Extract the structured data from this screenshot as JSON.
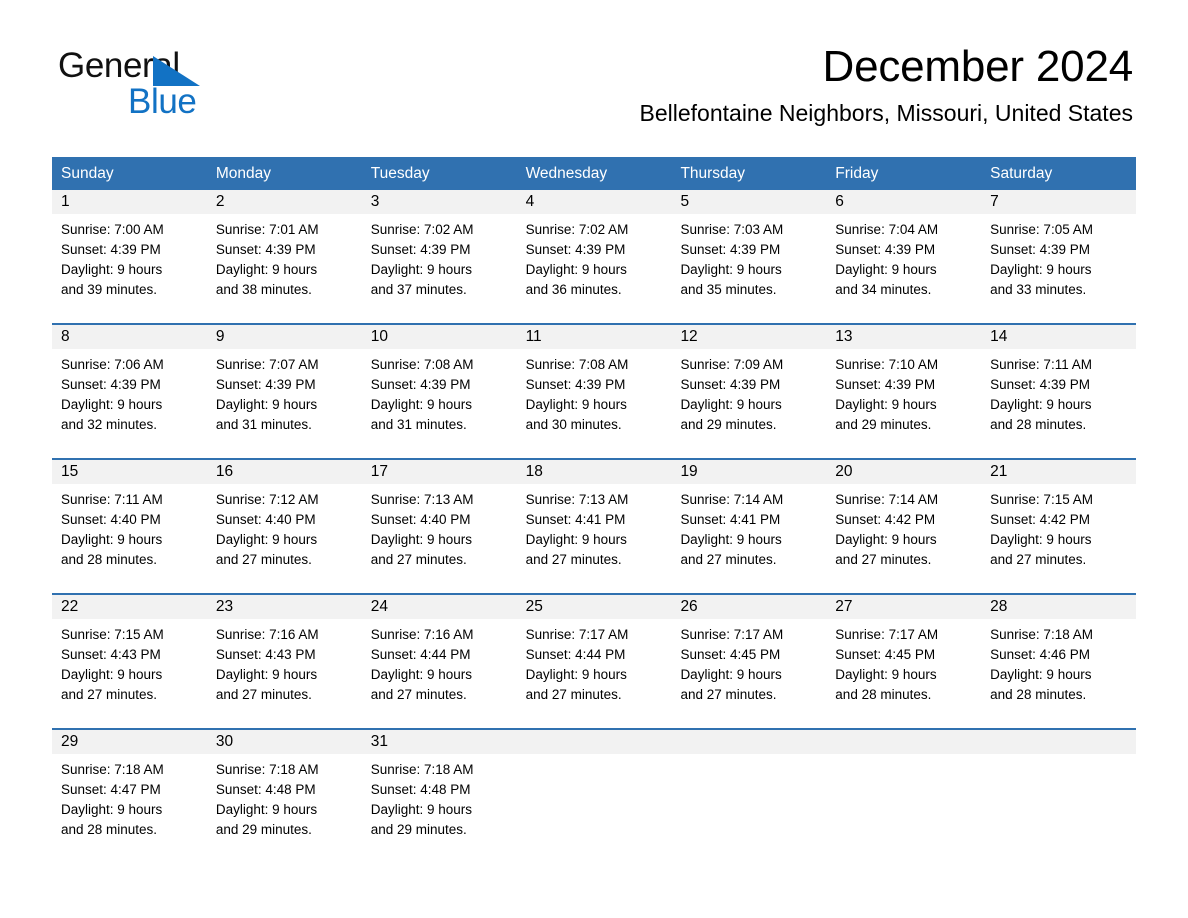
{
  "brand": {
    "name_part1": "General",
    "name_part2": "Blue",
    "logo_mark": "triangle-icon",
    "accent_color": "#1272c4"
  },
  "header": {
    "title": "December 2024",
    "location": "Bellefontaine Neighbors, Missouri, United States"
  },
  "calendar": {
    "header_color": "#3071b0",
    "daynum_strip_color": "#f2f2f2",
    "weekdays": [
      "Sunday",
      "Monday",
      "Tuesday",
      "Wednesday",
      "Thursday",
      "Friday",
      "Saturday"
    ],
    "weeks": [
      [
        {
          "day": "1",
          "sunrise": "Sunrise: 7:00 AM",
          "sunset": "Sunset: 4:39 PM",
          "daylight_line1": "Daylight: 9 hours",
          "daylight_line2": "and 39 minutes."
        },
        {
          "day": "2",
          "sunrise": "Sunrise: 7:01 AM",
          "sunset": "Sunset: 4:39 PM",
          "daylight_line1": "Daylight: 9 hours",
          "daylight_line2": "and 38 minutes."
        },
        {
          "day": "3",
          "sunrise": "Sunrise: 7:02 AM",
          "sunset": "Sunset: 4:39 PM",
          "daylight_line1": "Daylight: 9 hours",
          "daylight_line2": "and 37 minutes."
        },
        {
          "day": "4",
          "sunrise": "Sunrise: 7:02 AM",
          "sunset": "Sunset: 4:39 PM",
          "daylight_line1": "Daylight: 9 hours",
          "daylight_line2": "and 36 minutes."
        },
        {
          "day": "5",
          "sunrise": "Sunrise: 7:03 AM",
          "sunset": "Sunset: 4:39 PM",
          "daylight_line1": "Daylight: 9 hours",
          "daylight_line2": "and 35 minutes."
        },
        {
          "day": "6",
          "sunrise": "Sunrise: 7:04 AM",
          "sunset": "Sunset: 4:39 PM",
          "daylight_line1": "Daylight: 9 hours",
          "daylight_line2": "and 34 minutes."
        },
        {
          "day": "7",
          "sunrise": "Sunrise: 7:05 AM",
          "sunset": "Sunset: 4:39 PM",
          "daylight_line1": "Daylight: 9 hours",
          "daylight_line2": "and 33 minutes."
        }
      ],
      [
        {
          "day": "8",
          "sunrise": "Sunrise: 7:06 AM",
          "sunset": "Sunset: 4:39 PM",
          "daylight_line1": "Daylight: 9 hours",
          "daylight_line2": "and 32 minutes."
        },
        {
          "day": "9",
          "sunrise": "Sunrise: 7:07 AM",
          "sunset": "Sunset: 4:39 PM",
          "daylight_line1": "Daylight: 9 hours",
          "daylight_line2": "and 31 minutes."
        },
        {
          "day": "10",
          "sunrise": "Sunrise: 7:08 AM",
          "sunset": "Sunset: 4:39 PM",
          "daylight_line1": "Daylight: 9 hours",
          "daylight_line2": "and 31 minutes."
        },
        {
          "day": "11",
          "sunrise": "Sunrise: 7:08 AM",
          "sunset": "Sunset: 4:39 PM",
          "daylight_line1": "Daylight: 9 hours",
          "daylight_line2": "and 30 minutes."
        },
        {
          "day": "12",
          "sunrise": "Sunrise: 7:09 AM",
          "sunset": "Sunset: 4:39 PM",
          "daylight_line1": "Daylight: 9 hours",
          "daylight_line2": "and 29 minutes."
        },
        {
          "day": "13",
          "sunrise": "Sunrise: 7:10 AM",
          "sunset": "Sunset: 4:39 PM",
          "daylight_line1": "Daylight: 9 hours",
          "daylight_line2": "and 29 minutes."
        },
        {
          "day": "14",
          "sunrise": "Sunrise: 7:11 AM",
          "sunset": "Sunset: 4:39 PM",
          "daylight_line1": "Daylight: 9 hours",
          "daylight_line2": "and 28 minutes."
        }
      ],
      [
        {
          "day": "15",
          "sunrise": "Sunrise: 7:11 AM",
          "sunset": "Sunset: 4:40 PM",
          "daylight_line1": "Daylight: 9 hours",
          "daylight_line2": "and 28 minutes."
        },
        {
          "day": "16",
          "sunrise": "Sunrise: 7:12 AM",
          "sunset": "Sunset: 4:40 PM",
          "daylight_line1": "Daylight: 9 hours",
          "daylight_line2": "and 27 minutes."
        },
        {
          "day": "17",
          "sunrise": "Sunrise: 7:13 AM",
          "sunset": "Sunset: 4:40 PM",
          "daylight_line1": "Daylight: 9 hours",
          "daylight_line2": "and 27 minutes."
        },
        {
          "day": "18",
          "sunrise": "Sunrise: 7:13 AM",
          "sunset": "Sunset: 4:41 PM",
          "daylight_line1": "Daylight: 9 hours",
          "daylight_line2": "and 27 minutes."
        },
        {
          "day": "19",
          "sunrise": "Sunrise: 7:14 AM",
          "sunset": "Sunset: 4:41 PM",
          "daylight_line1": "Daylight: 9 hours",
          "daylight_line2": "and 27 minutes."
        },
        {
          "day": "20",
          "sunrise": "Sunrise: 7:14 AM",
          "sunset": "Sunset: 4:42 PM",
          "daylight_line1": "Daylight: 9 hours",
          "daylight_line2": "and 27 minutes."
        },
        {
          "day": "21",
          "sunrise": "Sunrise: 7:15 AM",
          "sunset": "Sunset: 4:42 PM",
          "daylight_line1": "Daylight: 9 hours",
          "daylight_line2": "and 27 minutes."
        }
      ],
      [
        {
          "day": "22",
          "sunrise": "Sunrise: 7:15 AM",
          "sunset": "Sunset: 4:43 PM",
          "daylight_line1": "Daylight: 9 hours",
          "daylight_line2": "and 27 minutes."
        },
        {
          "day": "23",
          "sunrise": "Sunrise: 7:16 AM",
          "sunset": "Sunset: 4:43 PM",
          "daylight_line1": "Daylight: 9 hours",
          "daylight_line2": "and 27 minutes."
        },
        {
          "day": "24",
          "sunrise": "Sunrise: 7:16 AM",
          "sunset": "Sunset: 4:44 PM",
          "daylight_line1": "Daylight: 9 hours",
          "daylight_line2": "and 27 minutes."
        },
        {
          "day": "25",
          "sunrise": "Sunrise: 7:17 AM",
          "sunset": "Sunset: 4:44 PM",
          "daylight_line1": "Daylight: 9 hours",
          "daylight_line2": "and 27 minutes."
        },
        {
          "day": "26",
          "sunrise": "Sunrise: 7:17 AM",
          "sunset": "Sunset: 4:45 PM",
          "daylight_line1": "Daylight: 9 hours",
          "daylight_line2": "and 27 minutes."
        },
        {
          "day": "27",
          "sunrise": "Sunrise: 7:17 AM",
          "sunset": "Sunset: 4:45 PM",
          "daylight_line1": "Daylight: 9 hours",
          "daylight_line2": "and 28 minutes."
        },
        {
          "day": "28",
          "sunrise": "Sunrise: 7:18 AM",
          "sunset": "Sunset: 4:46 PM",
          "daylight_line1": "Daylight: 9 hours",
          "daylight_line2": "and 28 minutes."
        }
      ],
      [
        {
          "day": "29",
          "sunrise": "Sunrise: 7:18 AM",
          "sunset": "Sunset: 4:47 PM",
          "daylight_line1": "Daylight: 9 hours",
          "daylight_line2": "and 28 minutes."
        },
        {
          "day": "30",
          "sunrise": "Sunrise: 7:18 AM",
          "sunset": "Sunset: 4:48 PM",
          "daylight_line1": "Daylight: 9 hours",
          "daylight_line2": "and 29 minutes."
        },
        {
          "day": "31",
          "sunrise": "Sunrise: 7:18 AM",
          "sunset": "Sunset: 4:48 PM",
          "daylight_line1": "Daylight: 9 hours",
          "daylight_line2": "and 29 minutes."
        },
        {
          "day": "",
          "sunrise": "",
          "sunset": "",
          "daylight_line1": "",
          "daylight_line2": ""
        },
        {
          "day": "",
          "sunrise": "",
          "sunset": "",
          "daylight_line1": "",
          "daylight_line2": ""
        },
        {
          "day": "",
          "sunrise": "",
          "sunset": "",
          "daylight_line1": "",
          "daylight_line2": ""
        },
        {
          "day": "",
          "sunrise": "",
          "sunset": "",
          "daylight_line1": "",
          "daylight_line2": ""
        }
      ]
    ]
  }
}
